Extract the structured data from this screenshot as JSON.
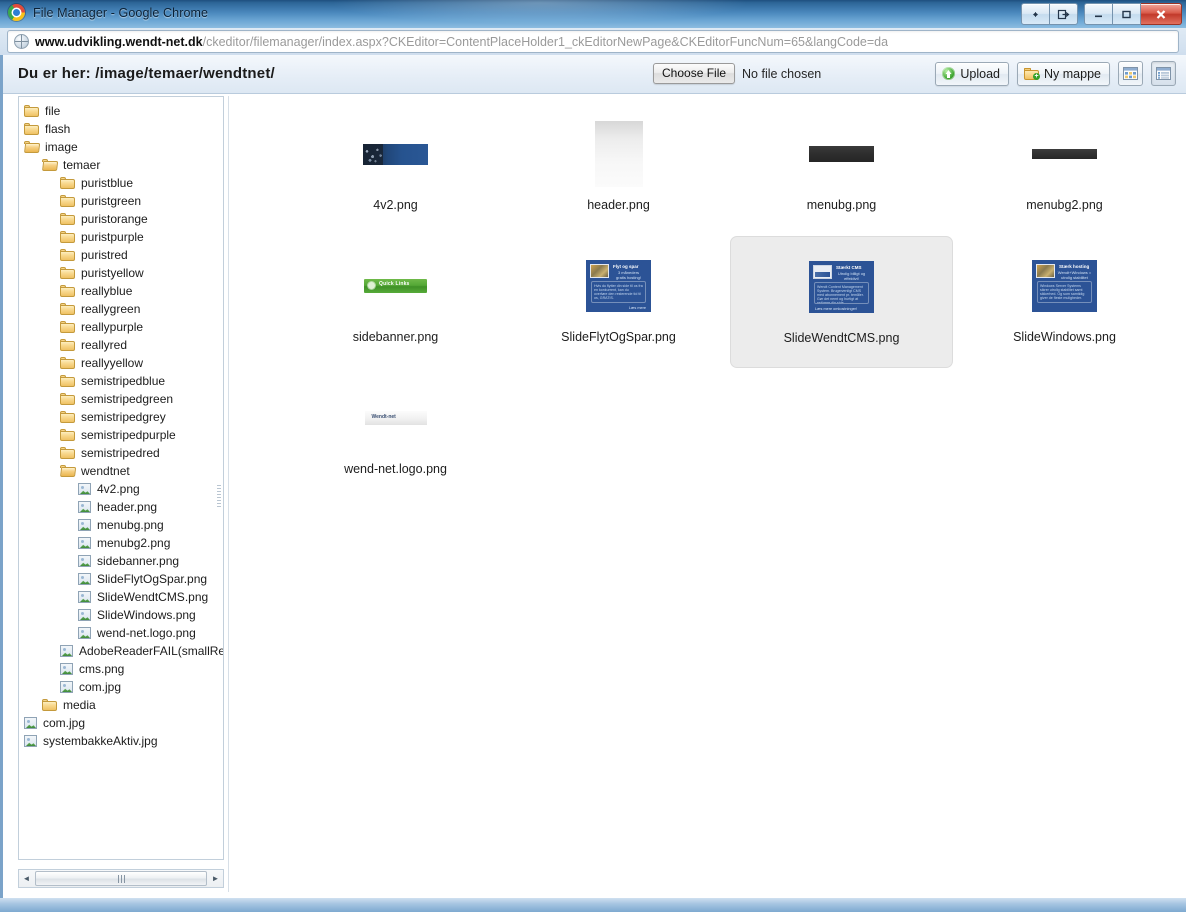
{
  "window": {
    "title": "File Manager - Google Chrome",
    "logo_icon": "chrome-logo-icon",
    "buttons": {
      "resize_label": "◀▶",
      "detach_label": "⇥",
      "minimize_label": "—",
      "maximize_label": "□",
      "close_label": "✕"
    }
  },
  "omnibox": {
    "icon": "globe-icon",
    "host": "www.udvikling.wendt-net.dk",
    "path": "/ckeditor/filemanager/index.aspx?CKEditor=ContentPlaceHolder1_ckEditorNewPage&CKEditorFuncNum=65&langCode=da"
  },
  "toolbar": {
    "breadcrumb_label": "Du er her:",
    "breadcrumb_path": "/image/temaer/wendtnet/",
    "choose_file_label": "Choose File",
    "no_file_label": "No file chosen",
    "upload_label": "Upload",
    "new_folder_label": "Ny mappe",
    "upload_icon": "upload-circle-icon",
    "new_folder_icon": "new-folder-icon",
    "thumbnail_view_icon": "grid-view-icon",
    "list_view_icon": "list-view-icon"
  },
  "tree": {
    "items": [
      {
        "label": "file",
        "type": "folder",
        "depth": 0,
        "state": "closed"
      },
      {
        "label": "flash",
        "type": "folder",
        "depth": 0,
        "state": "closed"
      },
      {
        "label": "image",
        "type": "folder",
        "depth": 0,
        "state": "open"
      },
      {
        "label": "temaer",
        "type": "folder",
        "depth": 1,
        "state": "open"
      },
      {
        "label": "puristblue",
        "type": "folder",
        "depth": 2,
        "state": "closed"
      },
      {
        "label": "puristgreen",
        "type": "folder",
        "depth": 2,
        "state": "closed"
      },
      {
        "label": "puristorange",
        "type": "folder",
        "depth": 2,
        "state": "closed"
      },
      {
        "label": "puristpurple",
        "type": "folder",
        "depth": 2,
        "state": "closed"
      },
      {
        "label": "puristred",
        "type": "folder",
        "depth": 2,
        "state": "closed"
      },
      {
        "label": "puristyellow",
        "type": "folder",
        "depth": 2,
        "state": "closed"
      },
      {
        "label": "reallyblue",
        "type": "folder",
        "depth": 2,
        "state": "closed"
      },
      {
        "label": "reallygreen",
        "type": "folder",
        "depth": 2,
        "state": "closed"
      },
      {
        "label": "reallypurple",
        "type": "folder",
        "depth": 2,
        "state": "closed"
      },
      {
        "label": "reallyred",
        "type": "folder",
        "depth": 2,
        "state": "closed"
      },
      {
        "label": "reallyyellow",
        "type": "folder",
        "depth": 2,
        "state": "closed"
      },
      {
        "label": "semistripedblue",
        "type": "folder",
        "depth": 2,
        "state": "closed"
      },
      {
        "label": "semistripedgreen",
        "type": "folder",
        "depth": 2,
        "state": "closed"
      },
      {
        "label": "semistripedgrey",
        "type": "folder",
        "depth": 2,
        "state": "closed"
      },
      {
        "label": "semistripedpurple",
        "type": "folder",
        "depth": 2,
        "state": "closed"
      },
      {
        "label": "semistripedred",
        "type": "folder",
        "depth": 2,
        "state": "closed"
      },
      {
        "label": "wendtnet",
        "type": "folder",
        "depth": 2,
        "state": "open"
      },
      {
        "label": "4v2.png",
        "type": "image",
        "depth": 3,
        "state": ""
      },
      {
        "label": "header.png",
        "type": "image",
        "depth": 3,
        "state": ""
      },
      {
        "label": "menubg.png",
        "type": "image",
        "depth": 3,
        "state": ""
      },
      {
        "label": "menubg2.png",
        "type": "image",
        "depth": 3,
        "state": ""
      },
      {
        "label": "sidebanner.png",
        "type": "image",
        "depth": 3,
        "state": ""
      },
      {
        "label": "SlideFlytOgSpar.png",
        "type": "image",
        "depth": 3,
        "state": ""
      },
      {
        "label": "SlideWendtCMS.png",
        "type": "image",
        "depth": 3,
        "state": ""
      },
      {
        "label": "SlideWindows.png",
        "type": "image",
        "depth": 3,
        "state": ""
      },
      {
        "label": "wend-net.logo.png",
        "type": "image",
        "depth": 3,
        "state": ""
      },
      {
        "label": "AdobeReaderFAIL(smallRes).",
        "type": "image",
        "depth": 2,
        "state": ""
      },
      {
        "label": "cms.png",
        "type": "image",
        "depth": 2,
        "state": ""
      },
      {
        "label": "com.jpg",
        "type": "image",
        "depth": 2,
        "state": ""
      },
      {
        "label": "media",
        "type": "folder",
        "depth": 1,
        "state": "closed"
      },
      {
        "label": "com.jpg",
        "type": "image",
        "depth": 0,
        "state": ""
      },
      {
        "label": "systembakkeAktiv.jpg",
        "type": "image",
        "depth": 0,
        "state": ""
      }
    ],
    "hscroll": {
      "left_arrow": "◄",
      "right_arrow": "►"
    }
  },
  "files": {
    "rows": [
      [
        {
          "name": "4v2.png",
          "thumb": "th-4v2",
          "selected": false
        },
        {
          "name": "header.png",
          "thumb": "th-header",
          "selected": false
        },
        {
          "name": "menubg.png",
          "thumb": "th-menubg",
          "selected": false
        },
        {
          "name": "menubg2.png",
          "thumb": "th-menubg2",
          "selected": false
        }
      ],
      [
        {
          "name": "sidebanner.png",
          "thumb": "th-sidebanner",
          "selected": false
        },
        {
          "name": "SlideFlytOgSpar.png",
          "thumb": "th-slide-flyt",
          "selected": false
        },
        {
          "name": "SlideWendtCMS.png",
          "thumb": "th-slide-cms",
          "selected": true
        },
        {
          "name": "SlideWindows.png",
          "thumb": "th-slide-win",
          "selected": false
        }
      ],
      [
        {
          "name": "wend-net.logo.png",
          "thumb": "th-wendtnet",
          "selected": false
        }
      ]
    ],
    "thumb_text": {
      "sidebanner_label": "Quick Links",
      "flyt": {
        "title": "Flyt og spar",
        "sub": "3 måneders\ngratis hosting!",
        "body": "Hvis du flytter din side til os fra en konkurrent, kan du overføre den resterende tid til os, GRATIS.",
        "more": "Læs mere"
      },
      "cms": {
        "title": "Stærkt CMS",
        "sub": "Utrolig billigt og effektivt!",
        "body": "Wendt Content Management System. Brugervenligt CMS med abonnement pr. temåler. Gør det nemt og hurtigt at redigere din side.",
        "more": "Læs mere omkostninger!"
      },
      "windows": {
        "title": "Stærk hosting",
        "sub": "Wendt+Windows = utrolig stabilitet",
        "body": "Windows Server Systems sikrer utrolig stabilitet samt sikkerhed. Og som samtidig giver de fleste muligheder.",
        "more": ""
      },
      "wendtnet_label": "Wendt-net"
    }
  },
  "colors": {
    "titlebar_blue": "#4a88bd",
    "close_red": "#c1392a",
    "selection_grey": "#ececec",
    "toolbar_bg": "#e6eef7",
    "slide_blue": "#2c5396",
    "banner_green": "#55a836"
  }
}
